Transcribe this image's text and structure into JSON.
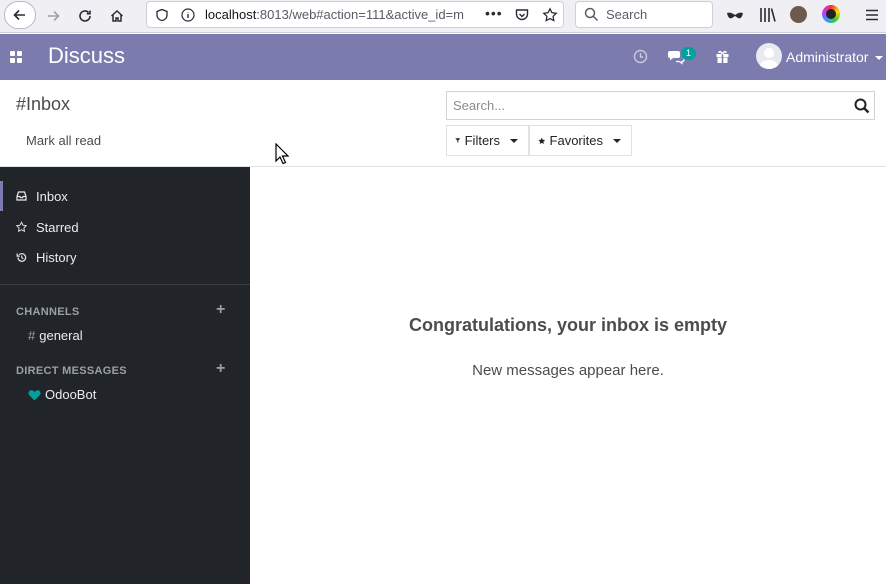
{
  "browser": {
    "url_host": "localhost",
    "url_rest": ":8013/web#action=111&active_id=m",
    "search_placeholder": "Search"
  },
  "navbar": {
    "app_title": "Discuss",
    "message_count": "1",
    "user_name": "Administrator"
  },
  "control_panel": {
    "breadcrumb": "#Inbox",
    "mark_all_read": "Mark all read",
    "search_placeholder": "Search...",
    "filters_label": "Filters",
    "favorites_label": "Favorites"
  },
  "sidebar": {
    "mailboxes": [
      {
        "label": "Inbox",
        "icon": "inbox-icon"
      },
      {
        "label": "Starred",
        "icon": "star-icon"
      },
      {
        "label": "History",
        "icon": "history-icon"
      }
    ],
    "channels_header": "CHANNELS",
    "channels": [
      {
        "label": "general"
      }
    ],
    "dm_header": "DIRECT MESSAGES",
    "direct_messages": [
      {
        "label": "OdooBot"
      }
    ]
  },
  "main": {
    "empty_title": "Congratulations, your inbox is empty",
    "empty_subtitle": "New messages appear here."
  },
  "colors": {
    "brand": "#7c7bad",
    "sidebar_bg": "#212529",
    "online": "#00a09d"
  }
}
